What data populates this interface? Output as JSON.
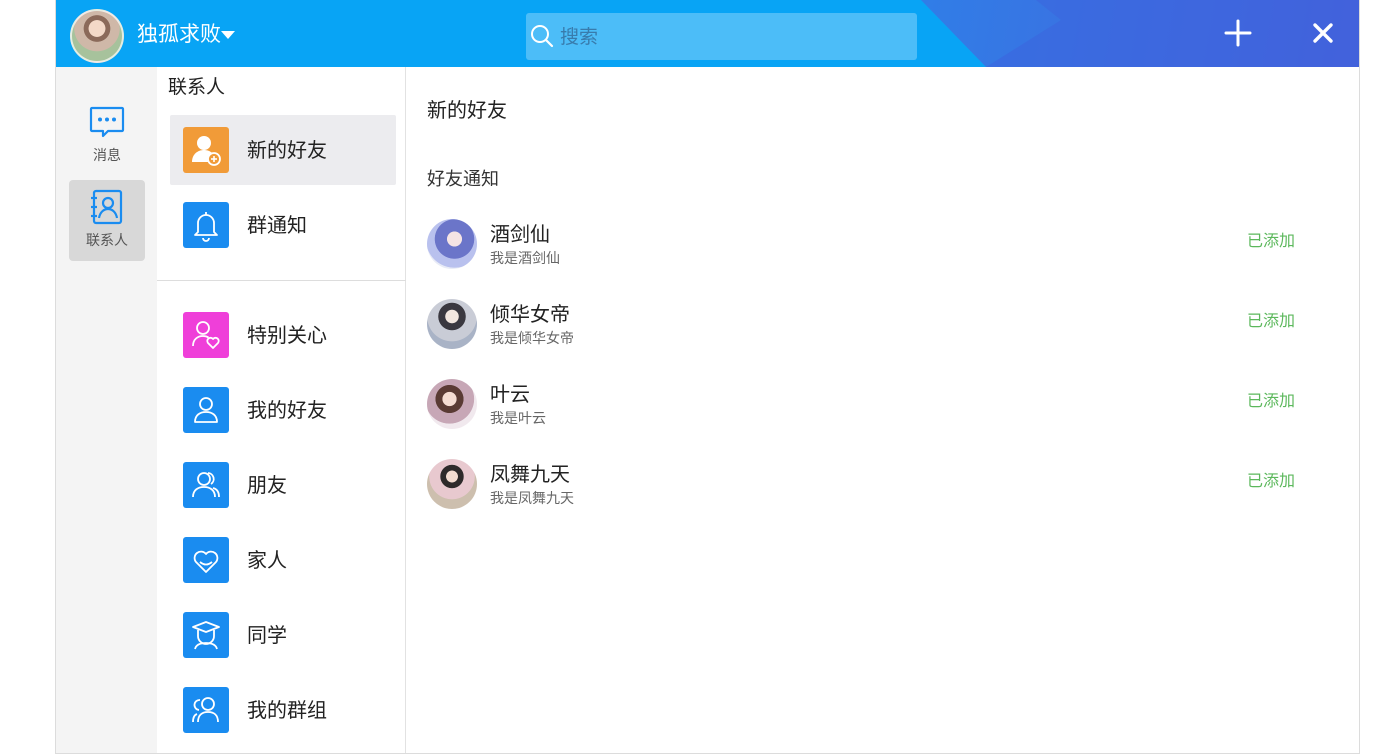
{
  "header": {
    "username": "独孤求败",
    "search_placeholder": "搜索",
    "colors": {
      "primary": "#08a4f5",
      "accent": "#3d64de"
    }
  },
  "rail": {
    "items": [
      {
        "label": "消息",
        "icon": "message-icon",
        "active": false
      },
      {
        "label": "联系人",
        "icon": "contacts-icon",
        "active": true
      }
    ]
  },
  "contacts": {
    "title": "联系人",
    "top_items": [
      {
        "label": "新的好友",
        "icon": "add-friend-icon",
        "color": "#f19b38",
        "active": true
      },
      {
        "label": "群通知",
        "icon": "bell-icon",
        "color": "#1a8cf0",
        "active": false
      }
    ],
    "groups": [
      {
        "label": "特别关心",
        "icon": "heart-user-icon",
        "color": "#ef3fd9"
      },
      {
        "label": "我的好友",
        "icon": "user-icon",
        "color": "#1a8cf0"
      },
      {
        "label": "朋友",
        "icon": "friends-icon",
        "color": "#1a8cf0"
      },
      {
        "label": "家人",
        "icon": "family-heart-icon",
        "color": "#1a8cf0"
      },
      {
        "label": "同学",
        "icon": "classmate-icon",
        "color": "#1a8cf0"
      },
      {
        "label": "我的群组",
        "icon": "group-icon",
        "color": "#1a8cf0"
      }
    ]
  },
  "main": {
    "title": "新的好友",
    "section_title": "好友通知",
    "notifications": [
      {
        "name": "酒剑仙",
        "message": "我是酒剑仙",
        "status": "已添加"
      },
      {
        "name": "倾华女帝",
        "message": "我是倾华女帝",
        "status": "已添加"
      },
      {
        "name": "叶云",
        "message": "我是叶云",
        "status": "已添加"
      },
      {
        "name": "凤舞九天",
        "message": "我是凤舞九天",
        "status": "已添加"
      }
    ],
    "status_color": "#5cb85c"
  }
}
